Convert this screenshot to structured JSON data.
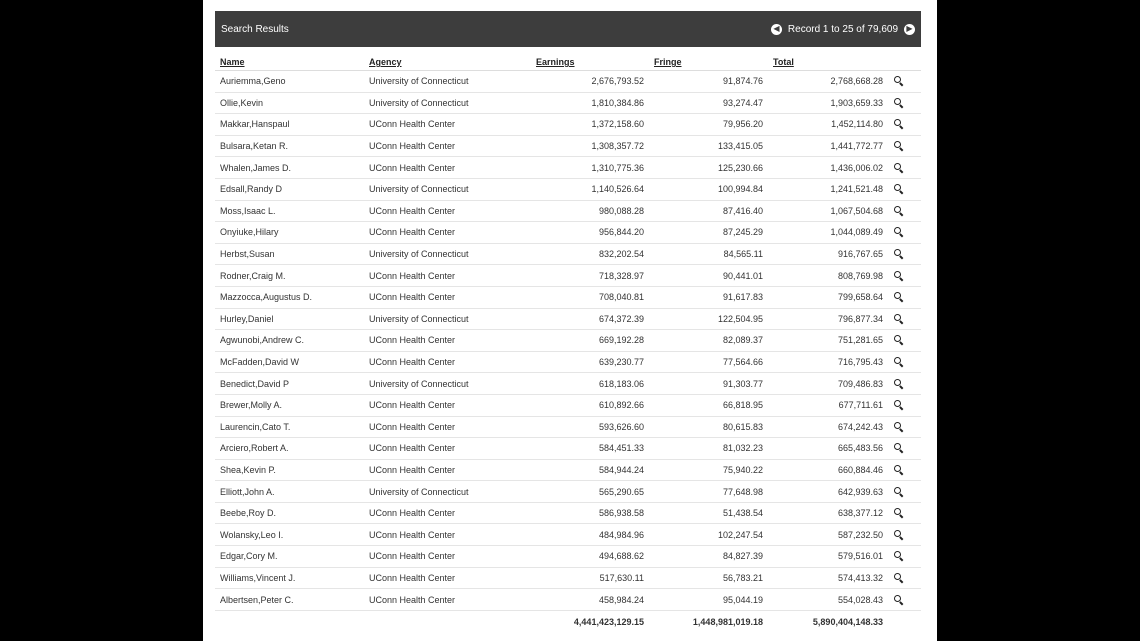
{
  "header": {
    "title": "Search Results",
    "pager_text": "Record 1 to 25 of 79,609",
    "prev_icon": "prev-arrow-icon",
    "next_icon": "next-arrow-icon"
  },
  "columns": [
    "Name",
    "Agency",
    "Earnings",
    "Fringe",
    "Total"
  ],
  "rows": [
    [
      "Auriemma,Geno",
      "University of Connecticut",
      "2,676,793.52",
      "91,874.76",
      "2,768,668.28"
    ],
    [
      "Ollie,Kevin",
      "University of Connecticut",
      "1,810,384.86",
      "93,274.47",
      "1,903,659.33"
    ],
    [
      "Makkar,Hanspaul",
      "UConn Health Center",
      "1,372,158.60",
      "79,956.20",
      "1,452,114.80"
    ],
    [
      "Bulsara,Ketan R.",
      "UConn Health Center",
      "1,308,357.72",
      "133,415.05",
      "1,441,772.77"
    ],
    [
      "Whalen,James D.",
      "UConn Health Center",
      "1,310,775.36",
      "125,230.66",
      "1,436,006.02"
    ],
    [
      "Edsall,Randy D",
      "University of Connecticut",
      "1,140,526.64",
      "100,994.84",
      "1,241,521.48"
    ],
    [
      "Moss,Isaac L.",
      "UConn Health Center",
      "980,088.28",
      "87,416.40",
      "1,067,504.68"
    ],
    [
      "Onyiuke,Hilary",
      "UConn Health Center",
      "956,844.20",
      "87,245.29",
      "1,044,089.49"
    ],
    [
      "Herbst,Susan",
      "University of Connecticut",
      "832,202.54",
      "84,565.11",
      "916,767.65"
    ],
    [
      "Rodner,Craig M.",
      "UConn Health Center",
      "718,328.97",
      "90,441.01",
      "808,769.98"
    ],
    [
      "Mazzocca,Augustus D.",
      "UConn Health Center",
      "708,040.81",
      "91,617.83",
      "799,658.64"
    ],
    [
      "Hurley,Daniel",
      "University of Connecticut",
      "674,372.39",
      "122,504.95",
      "796,877.34"
    ],
    [
      "Agwunobi,Andrew C.",
      "UConn Health Center",
      "669,192.28",
      "82,089.37",
      "751,281.65"
    ],
    [
      "McFadden,David W",
      "UConn Health Center",
      "639,230.77",
      "77,564.66",
      "716,795.43"
    ],
    [
      "Benedict,David P",
      "University of Connecticut",
      "618,183.06",
      "91,303.77",
      "709,486.83"
    ],
    [
      "Brewer,Molly A.",
      "UConn Health Center",
      "610,892.66",
      "66,818.95",
      "677,711.61"
    ],
    [
      "Laurencin,Cato T.",
      "UConn Health Center",
      "593,626.60",
      "80,615.83",
      "674,242.43"
    ],
    [
      "Arciero,Robert A.",
      "UConn Health Center",
      "584,451.33",
      "81,032.23",
      "665,483.56"
    ],
    [
      "Shea,Kevin P.",
      "UConn Health Center",
      "584,944.24",
      "75,940.22",
      "660,884.46"
    ],
    [
      "Elliott,John A.",
      "University of Connecticut",
      "565,290.65",
      "77,648.98",
      "642,939.63"
    ],
    [
      "Beebe,Roy D.",
      "UConn Health Center",
      "586,938.58",
      "51,438.54",
      "638,377.12"
    ],
    [
      "Wolansky,Leo I.",
      "UConn Health Center",
      "484,984.96",
      "102,247.54",
      "587,232.50"
    ],
    [
      "Edgar,Cory M.",
      "UConn Health Center",
      "494,688.62",
      "84,827.39",
      "579,516.01"
    ],
    [
      "Williams,Vincent J.",
      "UConn Health Center",
      "517,630.11",
      "56,783.21",
      "574,413.32"
    ],
    [
      "Albertsen,Peter C.",
      "UConn Health Center",
      "458,984.24",
      "95,044.19",
      "554,028.43"
    ]
  ],
  "totals": {
    "earnings": "4,441,423,129.15",
    "fringe": "1,448,981,019.18",
    "total": "5,890,404,148.33"
  },
  "colors": {
    "header_bg": "#3d3d3d",
    "page_bg": "#000000"
  }
}
